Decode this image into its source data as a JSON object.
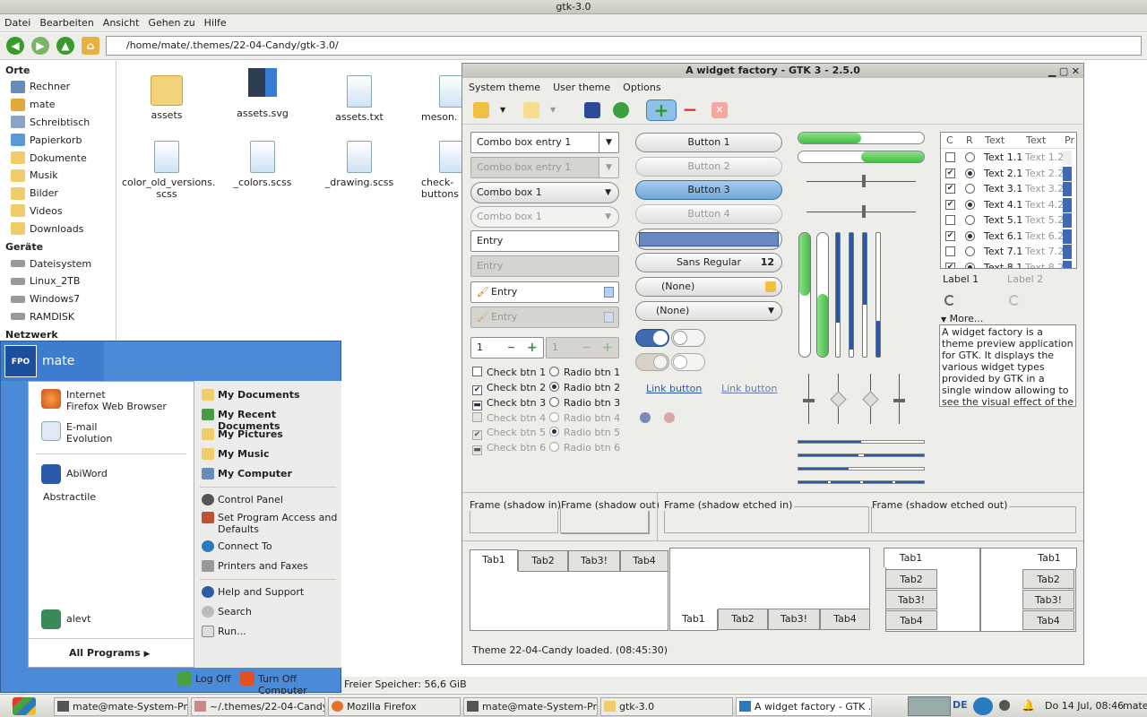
{
  "fm": {
    "title": "gtk-3.0",
    "menu": [
      "Datei",
      "Bearbeiten",
      "Ansicht",
      "Gehen zu",
      "Hilfe"
    ],
    "location": "/home/mate/.themes/22-04-Candy/gtk-3.0/",
    "sidebar": {
      "h_orte": "Orte",
      "orte": [
        "Rechner",
        "mate",
        "Schreibtisch",
        "Papierkorb",
        "Dokumente",
        "Musik",
        "Bilder",
        "Videos",
        "Downloads"
      ],
      "h_geraete": "Geräte",
      "geraete": [
        "Dateisystem",
        "Linux_2TB",
        "Windows7",
        "RAMDISK"
      ],
      "h_netz": "Netzwerk"
    },
    "files": [
      "assets",
      "assets.svg",
      "assets.txt",
      "meson.",
      "color_old_versions.\nscss",
      "_colors.scss",
      "_drawing.scss",
      "check-\nbuttons"
    ],
    "status": "Freier Speicher: 56,6 GiB"
  },
  "sm": {
    "user": "mate",
    "logo": "FPO",
    "left": {
      "internet": "Internet",
      "firefox": "Firefox Web Browser",
      "email": "E-mail",
      "evolution": "Evolution",
      "abiword": "AbiWord",
      "abstractile": "Abstractile",
      "alevt": "alevt",
      "all": "All Programs"
    },
    "right": [
      "My Documents",
      "My Recent Documents",
      "My Pictures",
      "My Music",
      "My Computer",
      "Control Panel",
      "Set Program Access and Defaults",
      "Connect To",
      "Printers and Faxes",
      "Help and Support",
      "Search",
      "Run..."
    ],
    "logoff": "Log Off",
    "turnoff": "Turn Off Computer"
  },
  "taskbar": {
    "items": [
      "mate@mate-System-Pr...",
      "~/.themes/22-04-Candy...",
      "Mozilla Firefox",
      "mate@mate-System-Pr...",
      "gtk-3.0",
      "A widget factory - GTK ..."
    ],
    "lang": "DE",
    "clock": "Do 14 Jul, 08:46",
    "user": "mate"
  },
  "wf": {
    "title": "A widget factory - GTK 3 - 2.5.0",
    "menu": [
      "System theme",
      "User theme",
      "Options"
    ],
    "combo1": "Combo box entry 1",
    "combo1d": "Combo box entry 1",
    "combo2": "Combo box 1",
    "combo2d": "Combo box 1",
    "entry": "Entry",
    "entry_d": "Entry",
    "entry2": "Entry",
    "entry2_d": "Entry",
    "spin": "1",
    "spin_d": "1",
    "buttons": [
      "Button 1",
      "Button 2",
      "Button 3",
      "Button 4"
    ],
    "font": "Sans Regular",
    "font_size": "12",
    "none1": "(None)",
    "none2": "(None)",
    "link1": "Link button",
    "link2": "Link button",
    "checks": [
      "Check btn 1",
      "Check btn 2",
      "Check btn 3",
      "Check btn 4",
      "Check btn 5",
      "Check btn 6"
    ],
    "radios": [
      "Radio btn 1",
      "Radio btn 2",
      "Radio btn 3",
      "Radio btn 4",
      "Radio btn 5",
      "Radio btn 6"
    ],
    "tree": {
      "headers": [
        "C",
        "R",
        "Text",
        "Text",
        "Pr"
      ],
      "rows": [
        [
          "Text 1.1",
          "Text 1.2"
        ],
        [
          "Text 2.1",
          "Text 2.2"
        ],
        [
          "Text 3.1",
          "Text 3.2"
        ],
        [
          "Text 4.1",
          "Text 4.2"
        ],
        [
          "Text 5.1",
          "Text 5.2"
        ],
        [
          "Text 6.1",
          "Text 6.2"
        ],
        [
          "Text 7.1",
          "Text 7.2"
        ],
        [
          "Text 8.1",
          "Text 8.2"
        ]
      ]
    },
    "label1": "Label 1",
    "label2": "Label 2",
    "more": "More...",
    "textview": "A widget factory is a theme preview application for GTK. It displays the various widget types provided by GTK in a single window allowing to see the visual effect of the applied theme. ~ A widget",
    "frames": [
      "Frame (shadow in)",
      "Frame (shadow out)",
      "Frame (shadow etched in)",
      "Frame (shadow etched out)"
    ],
    "tabs": [
      "Tab1",
      "Tab2",
      "Tab3!",
      "Tab4"
    ],
    "status": "Theme 22-04-Candy loaded.  (08:45:30)",
    "progress": [
      0.5,
      0.5
    ]
  }
}
